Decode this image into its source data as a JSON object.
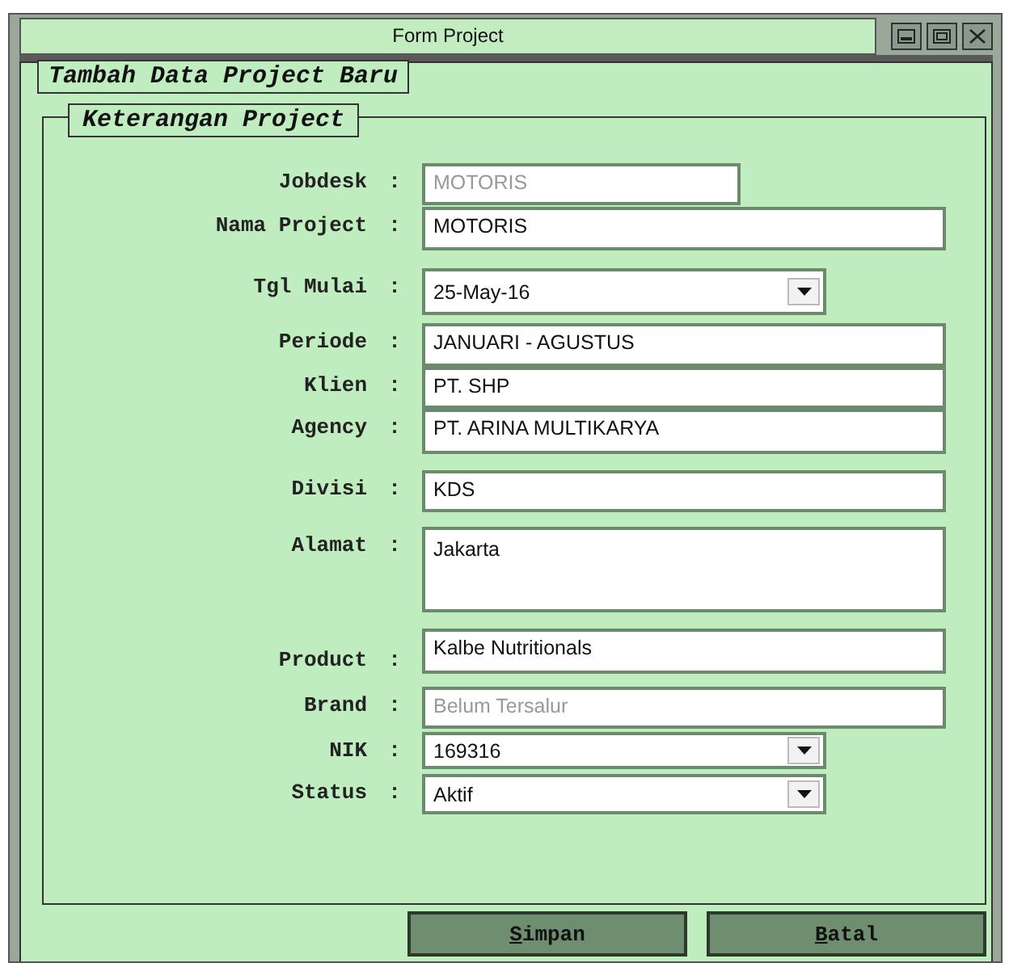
{
  "window": {
    "title": "Form Project"
  },
  "heading": "Tambah Data Project Baru",
  "group": {
    "title": "Keterangan Project",
    "fields": [
      {
        "label": "Jobdesk",
        "colon": ":",
        "kind": "short",
        "value": "MOTORIS",
        "disabled": true
      },
      {
        "label": "Nama Project",
        "colon": ":",
        "kind": "text",
        "value": "MOTORIS",
        "disabled": false
      },
      {
        "label": "Tgl Mulai",
        "colon": ":",
        "kind": "combo",
        "value": "25-May-16",
        "disabled": false
      },
      {
        "label": "Periode",
        "colon": ":",
        "kind": "text",
        "value": "JANUARI - AGUSTUS",
        "disabled": false
      },
      {
        "label": "Klien",
        "colon": ":",
        "kind": "text",
        "value": "PT. SHP",
        "disabled": false
      },
      {
        "label": "Agency",
        "colon": ":",
        "kind": "text",
        "value": "PT. ARINA MULTIKARYA",
        "disabled": false
      },
      {
        "label": "Divisi",
        "colon": ":",
        "kind": "text",
        "value": "KDS",
        "disabled": false
      },
      {
        "label": "Alamat",
        "colon": ":",
        "kind": "textarea",
        "value": "Jakarta",
        "disabled": false
      },
      {
        "label": "Product",
        "colon": ":",
        "kind": "text",
        "value": "Kalbe Nutritionals",
        "disabled": false
      },
      {
        "label": "Brand",
        "colon": ":",
        "kind": "text",
        "value": "Belum Tersalur",
        "disabled": true
      },
      {
        "label": "NIK",
        "colon": ":",
        "kind": "combo",
        "value": "169316",
        "disabled": false
      },
      {
        "label": "Status",
        "colon": ":",
        "kind": "combo",
        "value": "Aktif",
        "disabled": false
      }
    ]
  },
  "buttons": [
    "Simpan",
    "Batal"
  ]
}
